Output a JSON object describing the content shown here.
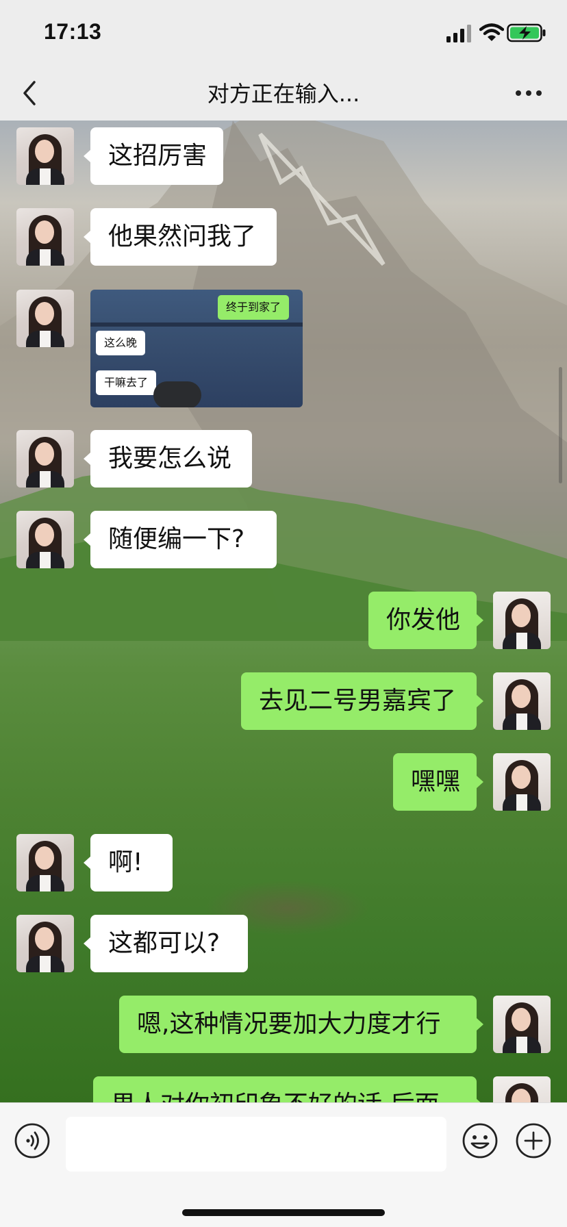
{
  "status_bar": {
    "time": "17:13"
  },
  "nav": {
    "title": "对方正在输入..."
  },
  "image_message": {
    "green": "终于到家了",
    "white1": "这么晚",
    "white2": "干嘛去了"
  },
  "messages": [
    {
      "dir": "in",
      "text": "这招厉害"
    },
    {
      "dir": "in",
      "text": "他果然问我了"
    },
    {
      "dir": "in",
      "text": "我要怎么说"
    },
    {
      "dir": "in",
      "text": "随便编一下?"
    },
    {
      "dir": "out",
      "text": "你发他"
    },
    {
      "dir": "out",
      "text": "去见二号男嘉宾了"
    },
    {
      "dir": "out",
      "text": "嘿嘿"
    },
    {
      "dir": "in",
      "text": "啊!"
    },
    {
      "dir": "in",
      "text": "这都可以?"
    },
    {
      "dir": "out",
      "text": "嗯,这种情况要加大力度才行"
    },
    {
      "dir": "out",
      "text": "男人对你初印象不好的话,后面"
    }
  ],
  "colors": {
    "outgoing_bubble": "#95ec69",
    "incoming_bubble": "#ffffff",
    "bar_bg": "#ededed"
  },
  "icons": [
    "back-chevron-icon",
    "more-dots-icon",
    "voice-icon",
    "emoji-icon",
    "plus-icon",
    "signal-icon",
    "wifi-icon",
    "battery-charging-icon"
  ]
}
